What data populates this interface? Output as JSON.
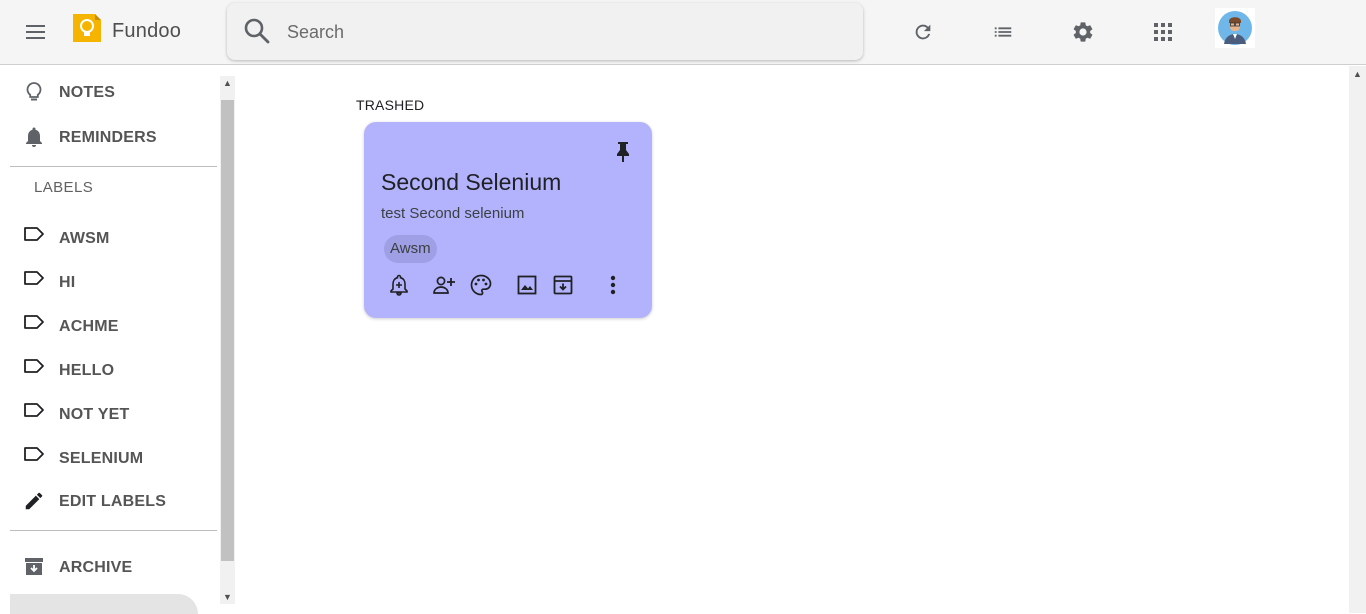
{
  "app": {
    "title": "Fundoo"
  },
  "search": {
    "placeholder": "Search",
    "value": ""
  },
  "toolbar": {
    "icons": [
      "menu-icon",
      "refresh-icon",
      "list-view-icon",
      "settings-icon",
      "apps-icon"
    ]
  },
  "sidebar": {
    "main_items": [
      {
        "label": "NOTES",
        "icon": "lightbulb-icon"
      },
      {
        "label": "REMINDERS",
        "icon": "bell-icon"
      }
    ],
    "labels_heading": "LABELS",
    "labels": [
      {
        "label": "AWSM",
        "icon": "label-icon"
      },
      {
        "label": "HI",
        "icon": "label-icon"
      },
      {
        "label": "ACHME",
        "icon": "label-icon"
      },
      {
        "label": "HELLO",
        "icon": "label-icon"
      },
      {
        "label": "NOT YET",
        "icon": "label-icon"
      },
      {
        "label": "SELENIUM",
        "icon": "label-icon"
      }
    ],
    "edit_labels": {
      "label": "EDIT LABELS",
      "icon": "pencil-icon"
    },
    "archive": {
      "label": "ARCHIVE",
      "icon": "archive-icon"
    }
  },
  "main": {
    "section_title": "TRASHED",
    "notes": [
      {
        "title": "Second Selenium",
        "body": "test Second selenium",
        "labels": [
          "Awsm"
        ],
        "color": "#b3b3fd",
        "pinned": true,
        "actions": [
          "add-reminder-icon",
          "collaborator-icon",
          "palette-icon",
          "image-icon",
          "archive-icon",
          "more-vert-icon"
        ]
      }
    ]
  },
  "colors": {
    "topbar": "#f5f5f5",
    "note": "#b3b3fd",
    "chip": "#9f9fe6",
    "logo": "#f4b400"
  }
}
